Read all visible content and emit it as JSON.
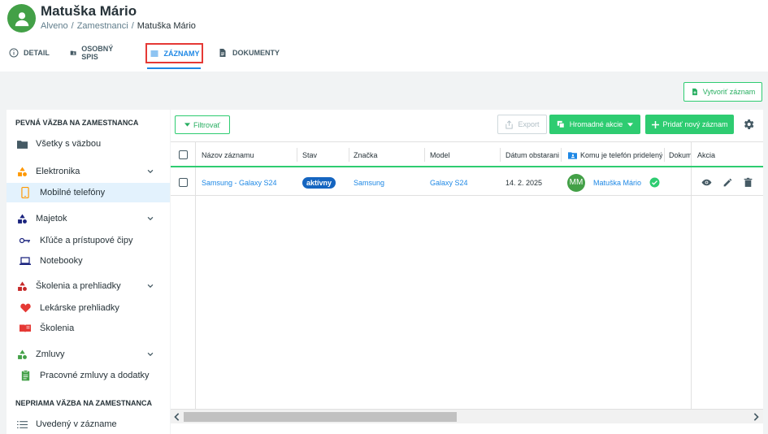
{
  "header": {
    "title": "Matuška Mário",
    "breadcrumb": [
      "Alveno",
      "Zamestnanci",
      "Matuška Mário"
    ]
  },
  "tabs": [
    {
      "label": "DETAIL"
    },
    {
      "label": "OSOBNÝ SPIS"
    },
    {
      "label": "ZÁZNAMY"
    },
    {
      "label": "DOKUMENTY"
    }
  ],
  "actions": {
    "create": "Vytvoriť záznam",
    "filter": "Filtrovať",
    "export": "Export",
    "bulk": "Hromadné akcie",
    "add": "Pridať nový záznam"
  },
  "sidebar": {
    "heading_direct": "PEVNÁ VÄZBA NA ZAMESTNANCA",
    "heading_indirect": "NEPRIAMA VÄZBA NA ZAMESTNANCA",
    "items": [
      {
        "label": "Všetky s väzbou"
      },
      {
        "label": "Elektronika"
      },
      {
        "label": "Mobilné telefóny"
      },
      {
        "label": "Majetok"
      },
      {
        "label": "Kľúče a prístupové čipy"
      },
      {
        "label": "Notebooky"
      },
      {
        "label": "Školenia a prehliadky"
      },
      {
        "label": "Lekárske prehliadky"
      },
      {
        "label": "Školenia"
      },
      {
        "label": "Zmluvy"
      },
      {
        "label": "Pracovné zmluvy a dodatky"
      },
      {
        "label": "Uvedený v zázname"
      }
    ]
  },
  "table": {
    "columns": [
      "Názov záznamu",
      "Stav",
      "Značka",
      "Model",
      "Dátum obstarania",
      "Komu je telefón pridelený (",
      "Dokum",
      "Akcia"
    ],
    "rows": [
      {
        "name": "Samsung - Galaxy S24",
        "status": "aktívny",
        "brand": "Samsung",
        "model": "Galaxy S24",
        "date": "14. 2. 2025",
        "initials": "MM",
        "assignee": "Matuška Mário"
      }
    ]
  },
  "colors": {
    "accent_green": "#2ecc71",
    "link_blue": "#1e88e5",
    "badge_blue": "#1565c0",
    "highlight_red": "#e53935"
  }
}
